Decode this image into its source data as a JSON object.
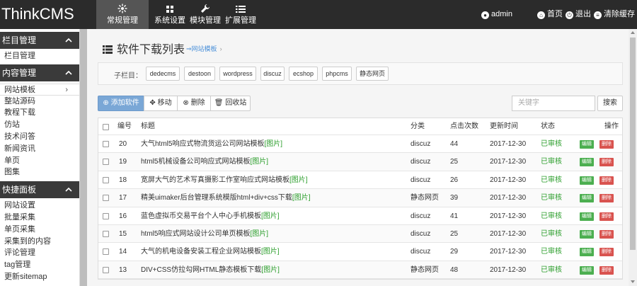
{
  "app": {
    "title": "ThinkCMS"
  },
  "nav": {
    "tabs": [
      {
        "label": "常规管理",
        "icon": "gear-icon"
      },
      {
        "label": "系统设置",
        "icon": "grid-icon"
      },
      {
        "label": "模块管理",
        "icon": "wrench-icon"
      },
      {
        "label": "扩展管理",
        "icon": "list-icon"
      }
    ],
    "user": "admin",
    "home": "首页",
    "logout": "退出",
    "clear_cache": "清除缓存"
  },
  "sidebar": {
    "sections": [
      {
        "title": "栏目管理",
        "items": [
          "栏目管理"
        ]
      },
      {
        "title": "内容管理",
        "items": [
          "网站模板",
          "整站源码",
          "教程下载",
          "仿站",
          "技术问答",
          "新闻资讯",
          "单页",
          "图集"
        ]
      },
      {
        "title": "快捷面板",
        "items": [
          "网站设置",
          "批量采集",
          "单页采集",
          "采集到的内容",
          "评论管理",
          "tag管理",
          "更新sitemap"
        ]
      }
    ],
    "active_item": "网站模板"
  },
  "page": {
    "title": "软件下载列表",
    "breadcrumb": "网站模板"
  },
  "subcategories": {
    "label": "子栏目：",
    "items": [
      "dedecms",
      "destoon",
      "wordpress",
      "discuz",
      "ecshop",
      "phpcms",
      "静态网页"
    ]
  },
  "toolbar": {
    "add": "添加软件",
    "move": "移动",
    "delete": "删除",
    "recycle": "回收站",
    "search_placeholder": "关键字",
    "search": "搜索"
  },
  "table": {
    "headers": {
      "id": "编号",
      "title": "标题",
      "category": "分类",
      "clicks": "点击次数",
      "updated": "更新时间",
      "status": "状态",
      "actions": "操作"
    },
    "edit_label": "编辑",
    "delete_label": "删除",
    "img_tag": "[图片]",
    "rows": [
      {
        "id": "20",
        "title": "大气html5响应式物流货运公司网站模板",
        "category": "discuz",
        "clicks": "44",
        "updated": "2017-12-30",
        "status": "已审核"
      },
      {
        "id": "19",
        "title": "html5机械设备公司响应式网站模板",
        "category": "discuz",
        "clicks": "25",
        "updated": "2017-12-30",
        "status": "已审核"
      },
      {
        "id": "18",
        "title": "宽屏大气的艺术写真摄影工作室响应式网站模板",
        "category": "discuz",
        "clicks": "26",
        "updated": "2017-12-30",
        "status": "已审核"
      },
      {
        "id": "17",
        "title": "精美uimaker后台管理系统模版html+div+css下载",
        "category": "静态网页",
        "clicks": "39",
        "updated": "2017-12-30",
        "status": "已审核"
      },
      {
        "id": "16",
        "title": "蓝色虚拟币交易平台个人中心手机模板",
        "category": "discuz",
        "clicks": "41",
        "updated": "2017-12-30",
        "status": "已审核"
      },
      {
        "id": "15",
        "title": "html5响应式网站设计公司单页模板",
        "category": "discuz",
        "clicks": "25",
        "updated": "2017-12-30",
        "status": "已审核"
      },
      {
        "id": "14",
        "title": "大气的机电设备安装工程企业网站模板",
        "category": "discuz",
        "clicks": "29",
        "updated": "2017-12-30",
        "status": "已审核"
      },
      {
        "id": "13",
        "title": "DIV+CSS仿拉勾网HTML静态模板下载",
        "category": "静态网页",
        "clicks": "48",
        "updated": "2017-12-30",
        "status": "已审核"
      }
    ]
  },
  "colors": {
    "topbar": "#2b2b2b",
    "status_green": "#2a9d2a",
    "edit_green": "#4caf50",
    "delete_red": "#d9534f",
    "primary_blue": "#7aa7d6"
  }
}
